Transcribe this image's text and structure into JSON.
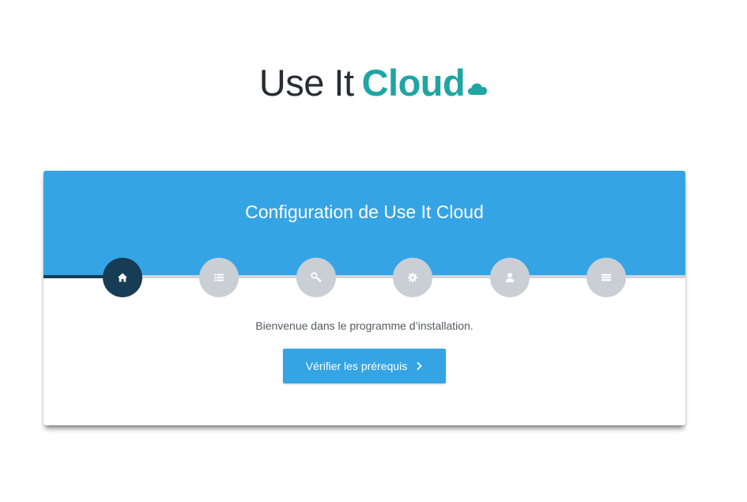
{
  "logo": {
    "part1": "Use It",
    "part2": "Cloud",
    "icon": "cloud-icon",
    "colors": {
      "dark": "#2a2d33",
      "accent": "#1fa5a3"
    }
  },
  "wizard": {
    "title": "Configuration de Use It Cloud",
    "steps": [
      {
        "icon": "home-icon",
        "status": "active"
      },
      {
        "icon": "list-icon",
        "status": "pending"
      },
      {
        "icon": "key-icon",
        "status": "pending"
      },
      {
        "icon": "gear-icon",
        "status": "pending"
      },
      {
        "icon": "user-icon",
        "status": "pending"
      },
      {
        "icon": "server-icon",
        "status": "pending"
      }
    ],
    "current_step": 1,
    "total_steps": 6,
    "welcome_text": "Bienvenue dans le programme d’installation.",
    "primary_button_label": "Vérifier les prérequis",
    "primary_button_icon": "chevron-right-icon",
    "colors": {
      "header": "#35a4e4",
      "active_step": "#173c55",
      "inactive_step": "#c9cfd4",
      "button": "#35a4e4"
    }
  }
}
